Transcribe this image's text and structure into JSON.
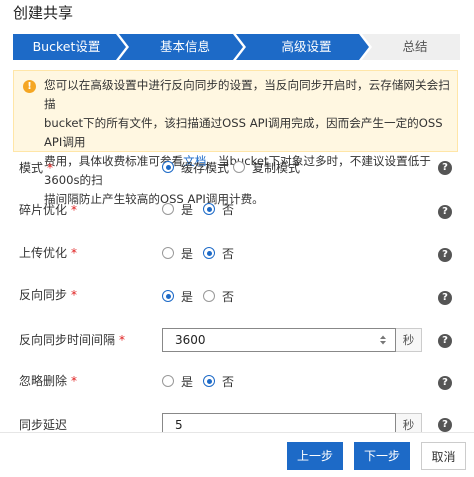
{
  "dialog": {
    "title": "创建共享"
  },
  "steps": [
    "Bucket设置",
    "基本信息",
    "高级设置",
    "总结"
  ],
  "notice": {
    "line1": "您可以在高级设置中进行反向同步的设置，当反向同步开启时，云存储网关会扫描",
    "line2": "bucket下的所有文件，该扫描通过OSS API调用完成，因而会产生一定的OSS API调用",
    "line3_before_link": "费用，具体收费标准可参看",
    "link_text": "文档",
    "line3_after_link": "。当bucket下对象过多时，不建议设置低于3600s的扫",
    "line4": "描间隔防止产生较高的OSS API调用计费。"
  },
  "form": {
    "mode": {
      "label": "模式",
      "options": [
        "缓存模式",
        "复制模式"
      ],
      "selected": 0
    },
    "fragment": {
      "label": "碎片优化",
      "options": [
        "是",
        "否"
      ],
      "selected": 1
    },
    "upload": {
      "label": "上传优化",
      "options": [
        "是",
        "否"
      ],
      "selected": 1
    },
    "reverse_sync": {
      "label": "反向同步",
      "options": [
        "是",
        "否"
      ],
      "selected": 0
    },
    "sync_interval": {
      "label": "反向同步时间间隔",
      "value": "3600",
      "unit": "秒"
    },
    "ignore_delete": {
      "label": "忽略删除",
      "options": [
        "是",
        "否"
      ],
      "selected": 1
    },
    "sync_delay": {
      "label": "同步延迟",
      "value": "5",
      "unit": "秒"
    },
    "required_mark": "*",
    "help_glyph": "?"
  },
  "buttons": {
    "prev": "上一步",
    "next": "下一步",
    "cancel": "取消"
  },
  "colors": {
    "accent": "#1d6ac7",
    "notice_bg": "#fff7e1",
    "warn": "#f5a623",
    "required": "#e02020"
  },
  "icons": {
    "notice": "warning-icon",
    "help": "help-icon",
    "spinner": "number-spinner-icon"
  }
}
